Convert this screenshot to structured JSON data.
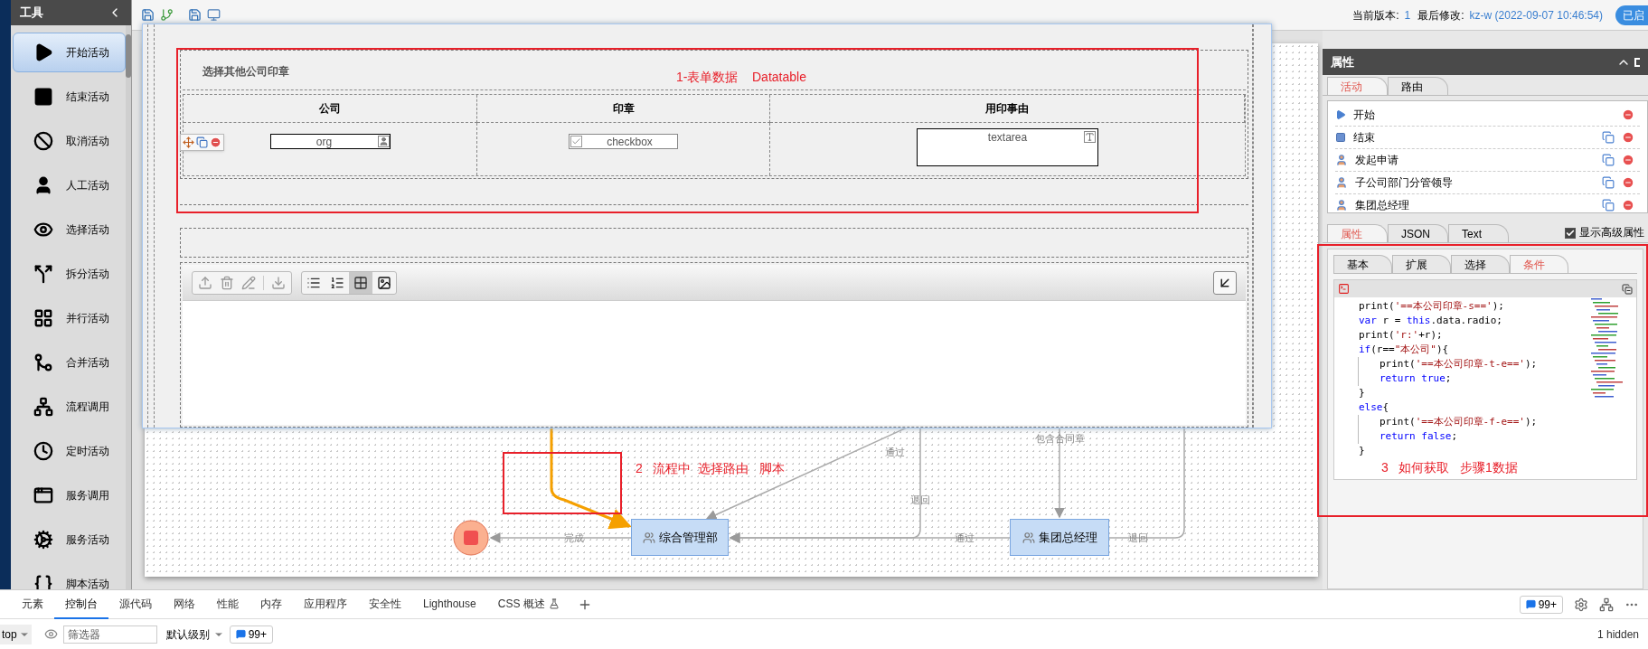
{
  "sidebar": {
    "title": "工具",
    "items": [
      {
        "label": "开始活动",
        "kind": "start",
        "selected": true
      },
      {
        "label": "结束活动",
        "kind": "end",
        "selected": false
      },
      {
        "label": "取消活动",
        "kind": "cancel",
        "selected": false
      },
      {
        "label": "人工活动",
        "kind": "manual",
        "selected": false
      },
      {
        "label": "选择活动",
        "kind": "choice",
        "selected": false
      },
      {
        "label": "拆分活动",
        "kind": "split",
        "selected": false
      },
      {
        "label": "并行活动",
        "kind": "parallel",
        "selected": false
      },
      {
        "label": "合并活动",
        "kind": "merge",
        "selected": false
      },
      {
        "label": "流程调用",
        "kind": "subprocess",
        "selected": false
      },
      {
        "label": "定时活动",
        "kind": "timer",
        "selected": false
      },
      {
        "label": "服务调用",
        "kind": "service",
        "selected": false
      },
      {
        "label": "服务活动",
        "kind": "service_activity",
        "selected": false
      },
      {
        "label": "脚本活动",
        "kind": "script",
        "selected": false
      }
    ]
  },
  "toolbar": {
    "version_label": "当前版本:",
    "version": "1",
    "modified_label": "最后修改:",
    "modified": "kz-w (2022-09-07 10:46:54)",
    "status_button": "已启"
  },
  "form_dialog": {
    "section_title": "选择其他公司印章",
    "annotation": "1-表单数据    Datatable",
    "table": {
      "columns": [
        "公司",
        "印章",
        "用印事由"
      ],
      "org_field": "org",
      "checkbox_field": "checkbox",
      "textarea_field": "textarea"
    }
  },
  "flow": {
    "annotation": "2   流程中  选择路由   脚本",
    "nodes": [
      {
        "label": "综合管理部"
      },
      {
        "label": "集团总经理"
      }
    ],
    "edges": [
      {
        "label": "完成"
      },
      {
        "label": "通过"
      },
      {
        "label": "退回"
      },
      {
        "label": "通过"
      },
      {
        "label": "退回"
      },
      {
        "label": "包含合同章"
      }
    ]
  },
  "properties": {
    "title": "属性",
    "tabs": [
      {
        "label": "活动",
        "selected": true
      },
      {
        "label": "路由",
        "selected": false
      }
    ],
    "activities": [
      {
        "label": "开始",
        "kind": "start"
      },
      {
        "label": "结束",
        "kind": "end"
      },
      {
        "label": "发起申请",
        "kind": "user"
      },
      {
        "label": "子公司部门分管领导",
        "kind": "user"
      },
      {
        "label": "集团总经理",
        "kind": "user"
      }
    ],
    "detail_tabs": [
      {
        "label": "属性",
        "selected": true
      },
      {
        "label": "JSON",
        "selected": false
      },
      {
        "label": "Text",
        "selected": false
      }
    ],
    "show_advanced": {
      "label": "显示高级属性",
      "checked": true
    },
    "condition_tabs": [
      {
        "label": "基本",
        "selected": false
      },
      {
        "label": "扩展",
        "selected": false
      },
      {
        "label": "选择",
        "selected": false
      },
      {
        "label": "条件",
        "selected": true
      }
    ],
    "code": [
      {
        "indent": false,
        "tokens": [
          {
            "kind": "plain",
            "text": "print("
          },
          {
            "kind": "string",
            "text": "'==本公司印章-s=='"
          },
          {
            "kind": "plain",
            "text": ");"
          }
        ]
      },
      {
        "indent": false,
        "tokens": [
          {
            "kind": "keyword",
            "text": "var "
          },
          {
            "kind": "plain",
            "text": "r = "
          },
          {
            "kind": "keyword",
            "text": "this"
          },
          {
            "kind": "plain",
            "text": ".data.radio;"
          }
        ]
      },
      {
        "indent": false,
        "tokens": [
          {
            "kind": "plain",
            "text": "print("
          },
          {
            "kind": "string",
            "text": "'r:'"
          },
          {
            "kind": "plain",
            "text": "+r);"
          }
        ]
      },
      {
        "indent": false,
        "tokens": [
          {
            "kind": "keyword",
            "text": "if"
          },
          {
            "kind": "plain",
            "text": "(r=="
          },
          {
            "kind": "string",
            "text": "\"本公司\""
          },
          {
            "kind": "plain",
            "text": "){"
          }
        ]
      },
      {
        "indent": true,
        "tokens": [
          {
            "kind": "plain",
            "text": "print("
          },
          {
            "kind": "string",
            "text": "'==本公司印章-t-e=='"
          },
          {
            "kind": "plain",
            "text": ");"
          }
        ]
      },
      {
        "indent": true,
        "tokens": [
          {
            "kind": "keyword",
            "text": "return "
          },
          {
            "kind": "keyword",
            "text": "true"
          },
          {
            "kind": "plain",
            "text": ";"
          }
        ]
      },
      {
        "indent": false,
        "tokens": [
          {
            "kind": "plain",
            "text": "}"
          }
        ]
      },
      {
        "indent": false,
        "tokens": [
          {
            "kind": "keyword",
            "text": "else"
          },
          {
            "kind": "plain",
            "text": "{"
          }
        ]
      },
      {
        "indent": true,
        "tokens": [
          {
            "kind": "plain",
            "text": "print("
          },
          {
            "kind": "string",
            "text": "'==本公司印章-f-e=='"
          },
          {
            "kind": "plain",
            "text": ");"
          }
        ]
      },
      {
        "indent": true,
        "tokens": [
          {
            "kind": "keyword",
            "text": "return "
          },
          {
            "kind": "keyword",
            "text": "false"
          },
          {
            "kind": "plain",
            "text": ";"
          }
        ]
      },
      {
        "indent": false,
        "tokens": [
          {
            "kind": "plain",
            "text": "}"
          }
        ]
      }
    ],
    "annotation": "3   如何获取   步骤1数据"
  },
  "devtools": {
    "tabs": [
      {
        "label": "元素",
        "selected": false
      },
      {
        "label": "控制台",
        "selected": true
      },
      {
        "label": "源代码",
        "selected": false
      },
      {
        "label": "网络",
        "selected": false
      },
      {
        "label": "性能",
        "selected": false
      },
      {
        "label": "内存",
        "selected": false
      },
      {
        "label": "应用程序",
        "selected": false
      },
      {
        "label": "安全性",
        "selected": false
      },
      {
        "label": "Lighthouse",
        "selected": false
      },
      {
        "label": "CSS 概述",
        "selected": false
      }
    ],
    "issues_badge": "99+",
    "context": "top",
    "filter_placeholder": "筛选器",
    "level": "默认级别",
    "filter_badge": "99+",
    "hidden": "1 hidden"
  }
}
